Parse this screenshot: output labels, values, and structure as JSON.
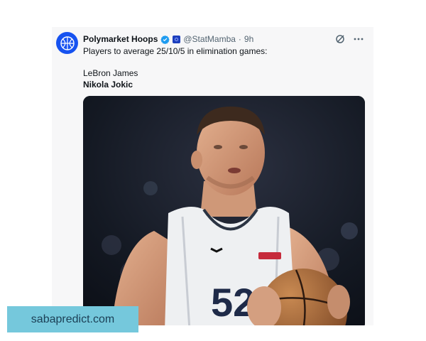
{
  "tweet": {
    "display_name": "Polymarket Hoops",
    "handle": "@StatMamba",
    "separator": "·",
    "time": "9h",
    "text": "Players to average 25/10/5 in elimination games:",
    "options": [
      "LeBron James",
      "Nikola Jokic"
    ]
  },
  "watermark": {
    "text": "sabapredict.com"
  },
  "colors": {
    "verified_badge": "#1d9bf0",
    "avatar_bg": "#1652f0",
    "watermark_bg": "#75c8dc",
    "watermark_text": "#1b3f55",
    "jersey_number": "52"
  },
  "icons": [
    "polymarket-logo-icon",
    "verified-badge-icon",
    "affiliate-badge-icon",
    "grok-icon",
    "more-icon"
  ]
}
